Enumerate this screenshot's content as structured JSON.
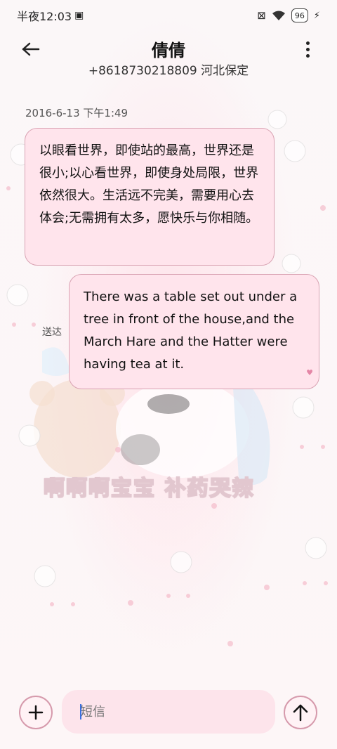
{
  "status_bar": {
    "time": "半夜12:03",
    "battery": "96"
  },
  "header": {
    "contact_name": "倩倩",
    "contact_detail": "+8618730218809 河北保定"
  },
  "conversation": {
    "timestamp": "2016-6-13 下午1:49",
    "incoming_message": "以眼看世界，即使站的最高，世界还是很小;以心看世界，即使身处局限，世界依然很大。生活远不完美，需要用心去体会;无需拥有太多，愿快乐与你相随。",
    "outgoing_message": "There was a table set out under a tree in front of the house,and the March Hare and the Hatter were having tea at it.",
    "delivery_status": "送达"
  },
  "wallpaper": {
    "caption": "啊啊啊宝宝 补药哭辣"
  },
  "composer": {
    "placeholder": "短信"
  },
  "colors": {
    "bubble": "#ffe4ec",
    "bubble_border": "#d9a3b3",
    "accent": "#d69aac"
  }
}
